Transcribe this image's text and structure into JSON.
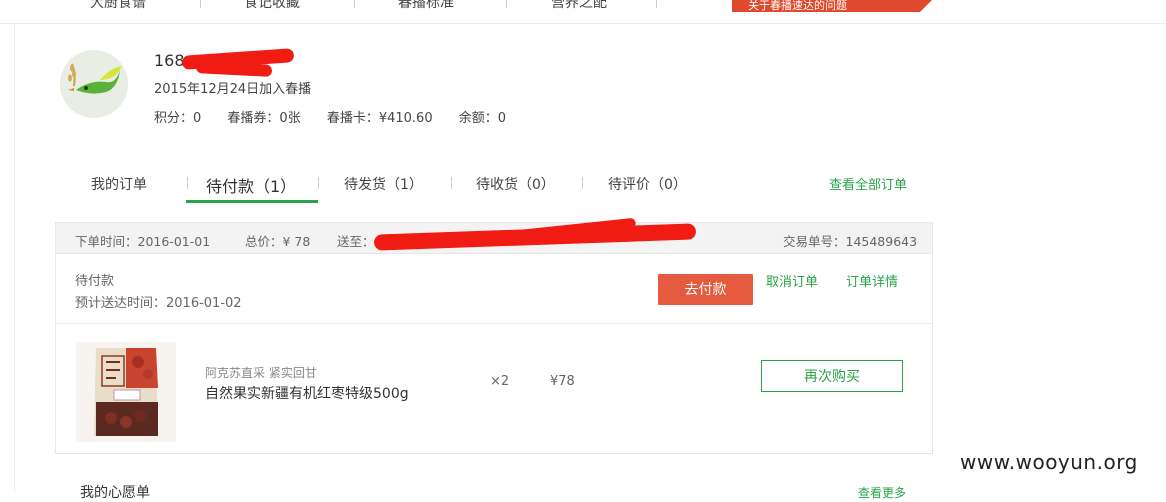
{
  "topnav": {
    "items": [
      "大厨食谱",
      "食记收藏",
      "春播标准",
      "营养之配"
    ],
    "promo": "关于春播速达的问题"
  },
  "user": {
    "name": "168",
    "joined": "2015年12月24日加入春播",
    "stats": [
      "积分：0",
      "春播券：0张",
      "春播卡：¥410.60",
      "余额：0"
    ]
  },
  "tabs": {
    "items": [
      "我的订单",
      "待付款（1）",
      "待发货（1）",
      "待收货（0）",
      "待评价（0）"
    ],
    "active_index": 1,
    "view_all": "查看全部订单"
  },
  "order": {
    "order_time": "下单时间：2016-01-01",
    "total": "总价：¥ 78",
    "ship_to": "送至：",
    "order_no": "交易单号：145489643",
    "status": "待付款",
    "eta": "预计送达时间：2016-01-02",
    "pay_label": "去付款",
    "cancel_label": "取消订单",
    "detail_label": "订单详情",
    "product": {
      "brand": "阿克苏直采 紧实回甘",
      "name": "自然果实新疆有机红枣特级500g",
      "qty": "×2",
      "price": "¥78",
      "rebuy_label": "再次购买"
    }
  },
  "wishlist": {
    "title": "我的心愿单",
    "more": "查看更多"
  },
  "watermark": "www.wooyun.org",
  "colors": {
    "accent_green": "#2aa34a",
    "pay_red": "#e65a3f",
    "redaction": "#f01c14"
  }
}
